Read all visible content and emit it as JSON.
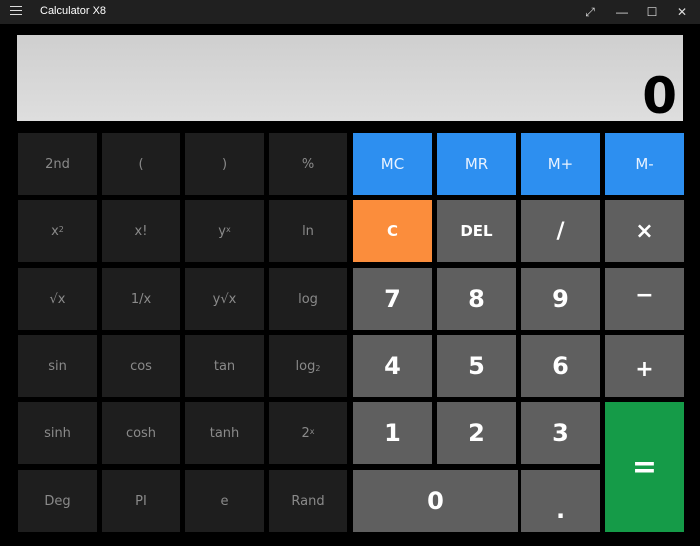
{
  "window": {
    "title": "Calculator X8",
    "menu_icon": "hamburger-menu-icon",
    "controls": {
      "fullscreen": "⤢",
      "minimize": "—",
      "maximize": "☐",
      "close": "✕"
    }
  },
  "display": {
    "value": "0"
  },
  "scientific": {
    "row1": [
      "2nd",
      "(",
      ")",
      "%"
    ],
    "row2": {
      "x2": "x",
      "x2_sup": "2",
      "fact": "x!",
      "yx": "y",
      "yx_sup": "x",
      "ln": "ln"
    },
    "row3": [
      "√x",
      "1/x",
      "y√x",
      "log"
    ],
    "row4": {
      "sin": "sin",
      "cos": "cos",
      "tan": "tan",
      "log2": "log",
      "log2_sub": "2"
    },
    "row5": {
      "sinh": "sinh",
      "cosh": "cosh",
      "tanh": "tanh",
      "pow2": "2",
      "pow2_sup": "x"
    },
    "row6": [
      "Deg",
      "PI",
      "e",
      "Rand"
    ]
  },
  "memory": [
    "MC",
    "MR",
    "M+",
    "M-"
  ],
  "ops": {
    "clear": "C",
    "delete": "DEL",
    "divide": "/",
    "multiply": "×",
    "subtract": "−",
    "add": "+",
    "equals": "=",
    "decimal": "."
  },
  "digits": [
    "0",
    "1",
    "2",
    "3",
    "4",
    "5",
    "6",
    "7",
    "8",
    "9"
  ],
  "colors": {
    "memory": "#2d8ff0",
    "clear": "#fb8d3c",
    "equals": "#159b48",
    "keypad": "#5f5f5f",
    "scientific": "#1e1e1e"
  }
}
